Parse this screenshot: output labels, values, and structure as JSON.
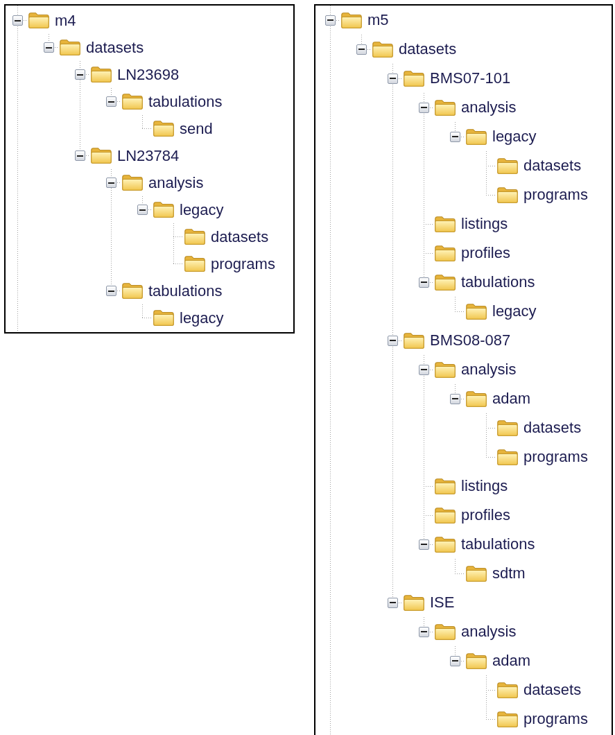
{
  "panels": [
    {
      "tree": [
        {
          "label": "m4",
          "expanded": true,
          "children": [
            {
              "label": "datasets",
              "expanded": true,
              "children": [
                {
                  "label": "LN23698",
                  "expanded": true,
                  "children": [
                    {
                      "label": "tabulations",
                      "expanded": true,
                      "children": [
                        {
                          "label": "send"
                        }
                      ]
                    }
                  ]
                },
                {
                  "label": "LN23784",
                  "expanded": true,
                  "children": [
                    {
                      "label": "analysis",
                      "expanded": true,
                      "children": [
                        {
                          "label": "legacy",
                          "expanded": true,
                          "children": [
                            {
                              "label": "datasets"
                            },
                            {
                              "label": "programs"
                            }
                          ]
                        }
                      ]
                    },
                    {
                      "label": "tabulations",
                      "expanded": true,
                      "children": [
                        {
                          "label": "legacy"
                        }
                      ]
                    }
                  ]
                }
              ]
            }
          ]
        }
      ]
    },
    {
      "tree": [
        {
          "label": "m5",
          "expanded": true,
          "children": [
            {
              "label": "datasets",
              "expanded": true,
              "children": [
                {
                  "label": "BMS07-101",
                  "expanded": true,
                  "children": [
                    {
                      "label": "analysis",
                      "expanded": true,
                      "children": [
                        {
                          "label": "legacy",
                          "expanded": true,
                          "children": [
                            {
                              "label": "datasets"
                            },
                            {
                              "label": "programs"
                            }
                          ]
                        }
                      ]
                    },
                    {
                      "label": "listings"
                    },
                    {
                      "label": "profiles"
                    },
                    {
                      "label": "tabulations",
                      "expanded": true,
                      "children": [
                        {
                          "label": "legacy"
                        }
                      ]
                    }
                  ]
                },
                {
                  "label": "BMS08-087",
                  "expanded": true,
                  "children": [
                    {
                      "label": "analysis",
                      "expanded": true,
                      "children": [
                        {
                          "label": "adam",
                          "expanded": true,
                          "children": [
                            {
                              "label": "datasets"
                            },
                            {
                              "label": "programs"
                            }
                          ]
                        }
                      ]
                    },
                    {
                      "label": "listings"
                    },
                    {
                      "label": "profiles"
                    },
                    {
                      "label": "tabulations",
                      "expanded": true,
                      "children": [
                        {
                          "label": "sdtm"
                        }
                      ]
                    }
                  ]
                },
                {
                  "label": "ISE",
                  "expanded": true,
                  "children": [
                    {
                      "label": "analysis",
                      "expanded": true,
                      "children": [
                        {
                          "label": "adam",
                          "expanded": true,
                          "children": [
                            {
                              "label": "datasets"
                            },
                            {
                              "label": "programs"
                            }
                          ]
                        }
                      ]
                    }
                  ]
                }
              ]
            }
          ]
        }
      ]
    }
  ]
}
